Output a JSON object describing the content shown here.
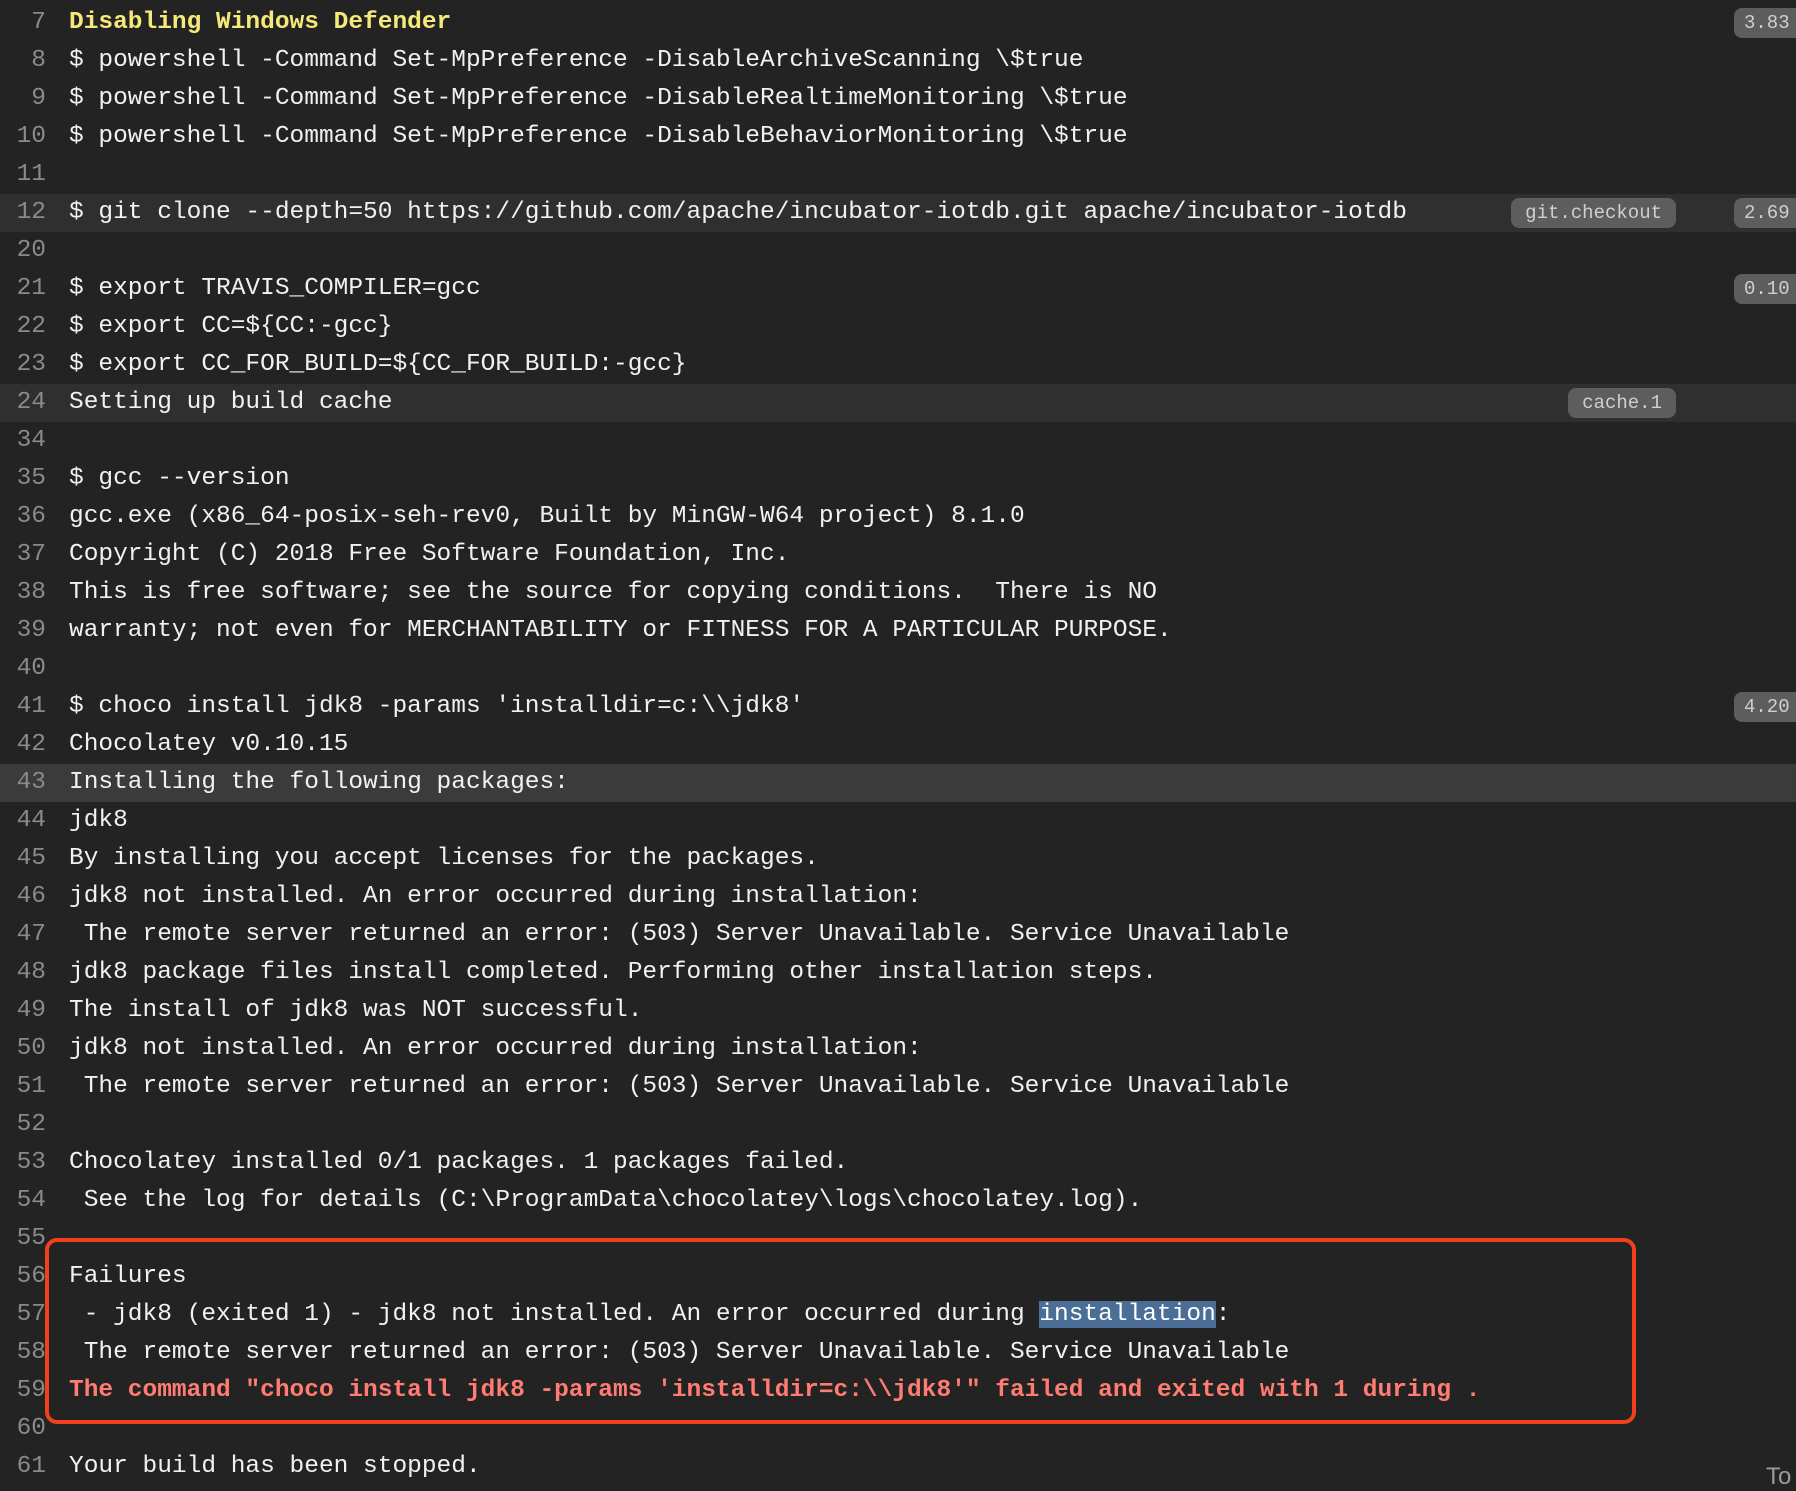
{
  "log": {
    "lines": [
      {
        "num": "7",
        "text": "Disabling Windows Defender",
        "style": "yellow",
        "duration": "3.83"
      },
      {
        "num": "8",
        "text": "$ powershell -Command Set-MpPreference -DisableArchiveScanning \\$true"
      },
      {
        "num": "9",
        "text": "$ powershell -Command Set-MpPreference -DisableRealtimeMonitoring \\$true"
      },
      {
        "num": "10",
        "text": "$ powershell -Command Set-MpPreference -DisableBehaviorMonitoring \\$true"
      },
      {
        "num": "11",
        "text": ""
      },
      {
        "num": "12",
        "text": "$ git clone --depth=50 https://github.com/apache/incubator-iotdb.git apache/incubator-iotdb",
        "folded": true,
        "tag": "git.checkout",
        "duration": "2.69"
      },
      {
        "num": "20",
        "text": ""
      },
      {
        "num": "21",
        "text": "$ export TRAVIS_COMPILER=gcc",
        "duration": "0.10"
      },
      {
        "num": "22",
        "text": "$ export CC=${CC:-gcc}"
      },
      {
        "num": "23",
        "text": "$ export CC_FOR_BUILD=${CC_FOR_BUILD:-gcc}"
      },
      {
        "num": "24",
        "text": "Setting up build cache",
        "folded": true,
        "tag": "cache.1"
      },
      {
        "num": "34",
        "text": ""
      },
      {
        "num": "35",
        "text": "$ gcc --version"
      },
      {
        "num": "36",
        "text": "gcc.exe (x86_64-posix-seh-rev0, Built by MinGW-W64 project) 8.1.0"
      },
      {
        "num": "37",
        "text": "Copyright (C) 2018 Free Software Foundation, Inc."
      },
      {
        "num": "38",
        "text": "This is free software; see the source for copying conditions.  There is NO"
      },
      {
        "num": "39",
        "text": "warranty; not even for MERCHANTABILITY or FITNESS FOR A PARTICULAR PURPOSE."
      },
      {
        "num": "40",
        "text": ""
      },
      {
        "num": "41",
        "text": "$ choco install jdk8 -params 'installdir=c:\\\\jdk8'",
        "duration": "4.20"
      },
      {
        "num": "42",
        "text": "Chocolatey v0.10.15"
      },
      {
        "num": "43",
        "text": "Installing the following packages:",
        "highlighted": true
      },
      {
        "num": "44",
        "text": "jdk8"
      },
      {
        "num": "45",
        "text": "By installing you accept licenses for the packages."
      },
      {
        "num": "46",
        "text": "jdk8 not installed. An error occurred during installation:"
      },
      {
        "num": "47",
        "text": " The remote server returned an error: (503) Server Unavailable. Service Unavailable"
      },
      {
        "num": "48",
        "text": "jdk8 package files install completed. Performing other installation steps."
      },
      {
        "num": "49",
        "text": "The install of jdk8 was NOT successful."
      },
      {
        "num": "50",
        "text": "jdk8 not installed. An error occurred during installation:"
      },
      {
        "num": "51",
        "text": " The remote server returned an error: (503) Server Unavailable. Service Unavailable"
      },
      {
        "num": "52",
        "text": ""
      },
      {
        "num": "53",
        "text": "Chocolatey installed 0/1 packages. 1 packages failed."
      },
      {
        "num": "54",
        "text": " See the log for details (C:\\ProgramData\\chocolatey\\logs\\chocolatey.log)."
      },
      {
        "num": "55",
        "text": ""
      },
      {
        "num": "56",
        "text": "Failures"
      },
      {
        "num": "57",
        "text": " - jdk8 (exited 1) - jdk8 not installed. An error occurred during ",
        "selected": "installation",
        "after": ":"
      },
      {
        "num": "58",
        "text": " The remote server returned an error: (503) Server Unavailable. Service Unavailable"
      },
      {
        "num": "59",
        "text": "The command \"choco install jdk8 -params 'installdir=c:\\\\jdk8'\" failed and exited with 1 during .",
        "style": "red"
      },
      {
        "num": "60",
        "text": ""
      },
      {
        "num": "61",
        "text": "Your build has been stopped."
      }
    ]
  },
  "scroll_to_top_hint": "To",
  "colors": {
    "background": "#232323",
    "folded_row": "#2f2f2f",
    "highlight_row": "#3b3b3b",
    "failure_box_border": "#f0401c",
    "error_text": "#ff7c73",
    "heading_text": "#f5e97a",
    "selection": "#4a6e96"
  }
}
